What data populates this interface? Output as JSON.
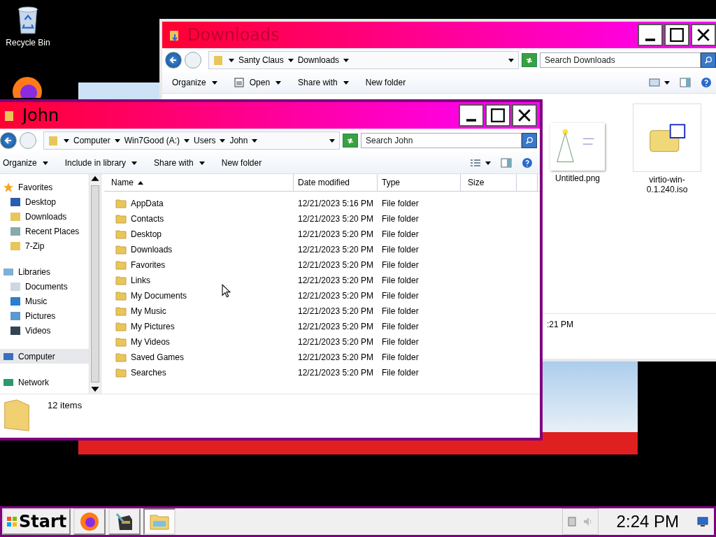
{
  "desktop_icons": [
    {
      "label": "Recycle Bin",
      "kind": "bin"
    }
  ],
  "downloads_window": {
    "title": "Downloads",
    "active": false,
    "breadcrumbs": [
      "Santy Claus",
      "Downloads"
    ],
    "search": {
      "placeholder": "Search Downloads"
    },
    "toolbar": [
      {
        "label": "Organize",
        "menu": true,
        "kind": "plain"
      },
      {
        "label": "Open",
        "menu": true,
        "kind": "open"
      },
      {
        "label": "Share with",
        "menu": true,
        "kind": "plain"
      },
      {
        "label": "New folder",
        "menu": false,
        "kind": "plain"
      }
    ],
    "files": [
      {
        "name": "Untitled.png",
        "kind": "image",
        "selected": false
      },
      {
        "name": "virtio-win-0.1.240.iso",
        "kind": "disc",
        "selected": false
      }
    ],
    "status_text": ":21 PM"
  },
  "john_window": {
    "title": "John",
    "active": true,
    "breadcrumbs": [
      "Computer",
      "Win7Good (A:)",
      "Users",
      "John"
    ],
    "search": {
      "placeholder": "Search John"
    },
    "toolbar": [
      {
        "label": "Organize",
        "menu": true
      },
      {
        "label": "Include in library",
        "menu": true
      },
      {
        "label": "Share with",
        "menu": true
      },
      {
        "label": "New folder",
        "menu": false
      }
    ],
    "nav_pane": [
      {
        "label": "Favorites",
        "kind": "star",
        "selected": false,
        "children": [
          {
            "label": "Desktop",
            "kind": "screen",
            "selected": false
          },
          {
            "label": "Downloads",
            "kind": "folder",
            "selected": false
          },
          {
            "label": "Recent Places",
            "kind": "recent",
            "selected": false
          },
          {
            "label": "7-Zip",
            "kind": "folder",
            "selected": false
          }
        ]
      },
      {
        "label": "Libraries",
        "kind": "library",
        "selected": false,
        "children": [
          {
            "label": "Documents",
            "kind": "document",
            "selected": false
          },
          {
            "label": "Music",
            "kind": "music",
            "selected": false
          },
          {
            "label": "Pictures",
            "kind": "picture",
            "selected": false
          },
          {
            "label": "Videos",
            "kind": "video",
            "selected": false
          }
        ]
      },
      {
        "label": "Computer",
        "kind": "computer",
        "selected": true
      },
      {
        "label": "Network",
        "kind": "network",
        "selected": false
      }
    ],
    "columns": [
      {
        "label": "Name",
        "sorted": true
      },
      {
        "label": "Date modified",
        "sorted": false
      },
      {
        "label": "Type",
        "sorted": false
      },
      {
        "label": "Size",
        "sorted": false
      }
    ],
    "rows": [
      {
        "name": "AppData",
        "date": "12/21/2023 5:16 PM",
        "type": "File folder",
        "selected": false
      },
      {
        "name": "Contacts",
        "date": "12/21/2023 5:20 PM",
        "type": "File folder",
        "selected": false
      },
      {
        "name": "Desktop",
        "date": "12/21/2023 5:20 PM",
        "type": "File folder",
        "selected": false
      },
      {
        "name": "Downloads",
        "date": "12/21/2023 5:20 PM",
        "type": "File folder",
        "selected": false
      },
      {
        "name": "Favorites",
        "date": "12/21/2023 5:20 PM",
        "type": "File folder",
        "selected": false
      },
      {
        "name": "Links",
        "date": "12/21/2023 5:20 PM",
        "type": "File folder",
        "selected": false
      },
      {
        "name": "My Documents",
        "date": "12/21/2023 5:20 PM",
        "type": "File folder",
        "selected": false
      },
      {
        "name": "My Music",
        "date": "12/21/2023 5:20 PM",
        "type": "File folder",
        "selected": false
      },
      {
        "name": "My Pictures",
        "date": "12/21/2023 5:20 PM",
        "type": "File folder",
        "selected": false
      },
      {
        "name": "My Videos",
        "date": "12/21/2023 5:20 PM",
        "type": "File folder",
        "selected": false
      },
      {
        "name": "Saved Games",
        "date": "12/21/2023 5:20 PM",
        "type": "File folder",
        "selected": false
      },
      {
        "name": "Searches",
        "date": "12/21/2023 5:20 PM",
        "type": "File folder",
        "selected": false
      }
    ],
    "item_count": "12 items"
  },
  "taskbar": {
    "start_label": "Start",
    "apps": [
      {
        "kind": "browser",
        "active": false
      },
      {
        "kind": "archive",
        "active": false
      },
      {
        "kind": "explorer",
        "active": true
      }
    ],
    "clock": "2:24 PM"
  }
}
